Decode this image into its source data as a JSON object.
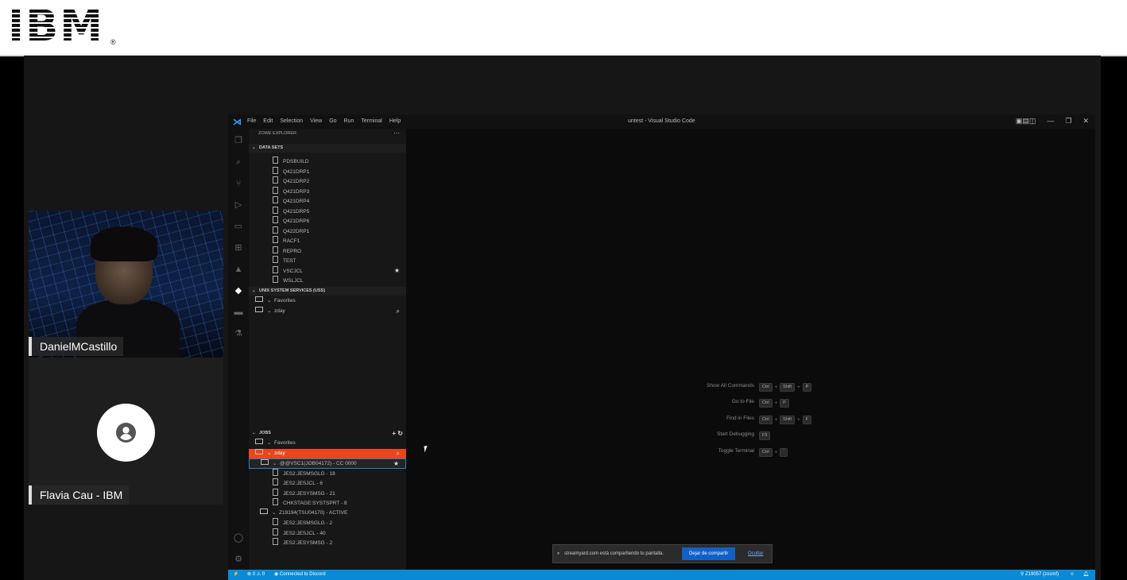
{
  "brand": {
    "logo_text": "IBM",
    "trademark": "®"
  },
  "participants": [
    {
      "name": "DanielMCastillo",
      "camera": "on"
    },
    {
      "name": "Flavia Cau - IBM",
      "camera": "off"
    }
  ],
  "vscode": {
    "menu": [
      "File",
      "Edit",
      "Selection",
      "View",
      "Go",
      "Run",
      "Terminal",
      "Help"
    ],
    "window_title": "untest - Visual Studio Code",
    "sidebar_title": "ZOWE EXPLORER",
    "sidebar_more": "···",
    "data_sets_header": "DATA SETS",
    "data_sets": [
      "PDSBUILD",
      "Q421DRP1",
      "Q421DRP2",
      "Q421DRP3",
      "Q421DRP4",
      "Q421DRP5",
      "Q421DRP6",
      "Q422DRP1",
      "RACF1",
      "REPRO",
      "TEST",
      "VSCJCL",
      "WSLJCL"
    ],
    "uss_header": "UNIX SYSTEM SERVICES (USS)",
    "uss_items": [
      "Favorites",
      "zday"
    ],
    "jobs_header": "JOBS",
    "jobs_favorites": "Favorites",
    "jobs_profile": "zday",
    "job1": {
      "label": "@@VSC1(JOB04172) - CC 0000",
      "spools": [
        "JES2:JESMSGLG - 18",
        "JES2:JESJCL - 6",
        "JES2:JESYSMSG - 21",
        "CHKSTAGE:SYSTSPRT - 8"
      ]
    },
    "job2": {
      "label": "Z19194(TSU04170) - ACTIVE",
      "spools": [
        "JES2:JESMSGLG - 2",
        "JES2:JESJCL - 40",
        "JES2:JESYSMSG - 2"
      ]
    },
    "shortcuts": [
      {
        "label": "Show All Commands",
        "keys": [
          "Ctrl",
          "Shift",
          "P"
        ]
      },
      {
        "label": "Go to File",
        "keys": [
          "Ctrl",
          "P"
        ]
      },
      {
        "label": "Find in Files",
        "keys": [
          "Ctrl",
          "Shift",
          "F"
        ]
      },
      {
        "label": "Start Debugging",
        "keys": [
          "F5"
        ]
      },
      {
        "label": "Toggle Terminal",
        "keys": [
          "Ctrl",
          "`"
        ]
      }
    ],
    "status_left": "⊗ 0 ⚠ 0",
    "status_discord": "Connected to Discord",
    "status_right": "Z19057 (zosmf)"
  },
  "share_notice": {
    "text": "streamyard.com está compartiendo tu pantalla.",
    "stop_button": "Dejar de compartir",
    "hide_link": "Ocultar"
  },
  "colors": {
    "accent_orange": "#e8461d",
    "status_blue": "#0a8ad6"
  }
}
